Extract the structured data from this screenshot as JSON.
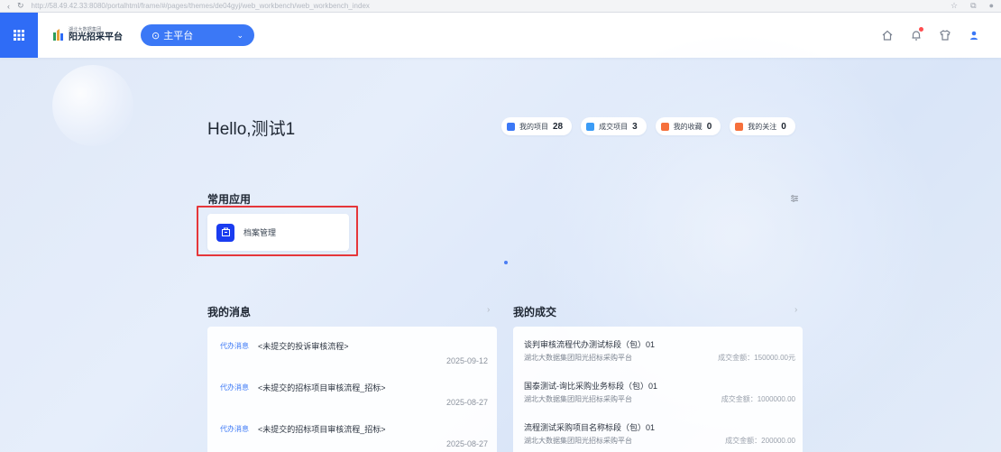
{
  "browser": {
    "url": "http://58.49.42.33:8080/portalhtml/frame/#/pages/themes/de04gyj/web_workbench/web_workbench_index"
  },
  "header": {
    "logo_sub": "湖北大数据集团",
    "logo_main": "阳光招采平台",
    "platform_select": "主平台",
    "icons": [
      "grid-icon",
      "location-icon",
      "home-icon",
      "bell-icon",
      "shirt-icon",
      "user-icon"
    ]
  },
  "greeting": "Hello,测试1",
  "stats": [
    {
      "label": "我的项目",
      "value": "28",
      "color": "#3b78f6"
    },
    {
      "label": "成交项目",
      "value": "3",
      "color": "#3b9cf6"
    },
    {
      "label": "我的收藏",
      "value": "0",
      "color": "#f6703b"
    },
    {
      "label": "我的关注",
      "value": "0",
      "color": "#f6703b"
    }
  ],
  "apps": {
    "title": "常用应用",
    "items": [
      {
        "label": "档案管理",
        "color": "#1a3cf0"
      }
    ]
  },
  "messages": {
    "title": "我的消息",
    "items": [
      {
        "tag": "代办消息",
        "text": "<未提交的投诉审核流程>",
        "date": "2025-09-12"
      },
      {
        "tag": "代办消息",
        "text": "<未提交的招标项目审核流程_招标>",
        "date": "2025-08-27"
      },
      {
        "tag": "代办消息",
        "text": "<未提交的招标项目审核流程_招标>",
        "date": "2025-08-27"
      }
    ]
  },
  "deals": {
    "title": "我的成交",
    "items": [
      {
        "name": "谈判审核流程代办测试标段（包）01",
        "org": "湖北大数据集团阳光招标采购平台",
        "amount": "成交金额：150000.00元"
      },
      {
        "name": "国泰测试-询比采购业务标段（包）01",
        "org": "湖北大数据集团阳光招标采购平台",
        "amount": "成交金额：1000000.00"
      },
      {
        "name": "流程测试采购项目名称标段（包）01",
        "org": "湖北大数据集团阳光招标采购平台",
        "amount": "成交金额：200000.00"
      }
    ]
  }
}
